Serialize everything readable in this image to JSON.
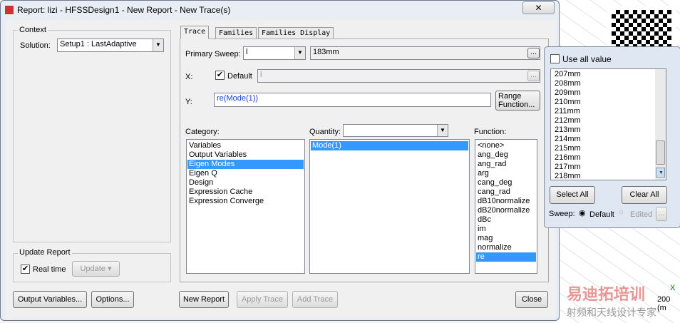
{
  "window": {
    "title": "Report: lizi - HFSSDesign1 - New Report - New Trace(s)",
    "close": "✕"
  },
  "context": {
    "label": "Context",
    "solution_label": "Solution:",
    "solution_value": "Setup1 : LastAdaptive"
  },
  "update": {
    "label": "Update Report",
    "realtime": "Real time",
    "realtime_checked": true,
    "update_btn": "Update"
  },
  "bottom": {
    "output_vars": "Output Variables...",
    "options": "Options...",
    "new_report": "New Report",
    "apply_trace": "Apply Trace",
    "add_trace": "Add Trace",
    "close": "Close"
  },
  "tabs": [
    "Trace",
    "Families",
    "Families Display"
  ],
  "trace": {
    "primary_sweep_label": "Primary Sweep:",
    "primary_sweep_value": "l",
    "primary_sweep_range": "183mm",
    "ellipsis": "...",
    "x_label": "X:",
    "x_default": "Default",
    "x_value": "l",
    "y_label": "Y:",
    "y_value": "re(Mode(1))",
    "range_function": "Range",
    "range_function2": "Function..."
  },
  "category": {
    "label": "Category:",
    "items": [
      "Variables",
      "Output Variables",
      "Eigen Modes",
      "Eigen Q",
      "Design",
      "Expression Cache",
      "Expression Converge"
    ],
    "selected": 2
  },
  "quantity": {
    "label": "Quantity:",
    "items": [
      "Mode(1)"
    ],
    "selected": 0
  },
  "function": {
    "label": "Function:",
    "items": [
      "<none>",
      "ang_deg",
      "ang_rad",
      "arg",
      "cang_deg",
      "cang_rad",
      "dB10normalize",
      "dB20normalize",
      "dBc",
      "im",
      "mag",
      "normalize",
      "re"
    ],
    "selected": 12
  },
  "popup": {
    "use_all": "Use all value",
    "values": [
      "207mm",
      "208mm",
      "209mm",
      "210mm",
      "211mm",
      "212mm",
      "213mm",
      "214mm",
      "215mm",
      "216mm",
      "217mm",
      "218mm"
    ],
    "select_all": "Select All",
    "clear_all": "Clear All",
    "sweep_label": "Sweep:",
    "default": "Default",
    "edited": "Edited",
    "ellipsis": "..."
  },
  "watermark": {
    "brand": "易迪拓培训",
    "slogan": "射频和天线设计专家",
    "axis": "X",
    "axis_value": "200 (m"
  }
}
